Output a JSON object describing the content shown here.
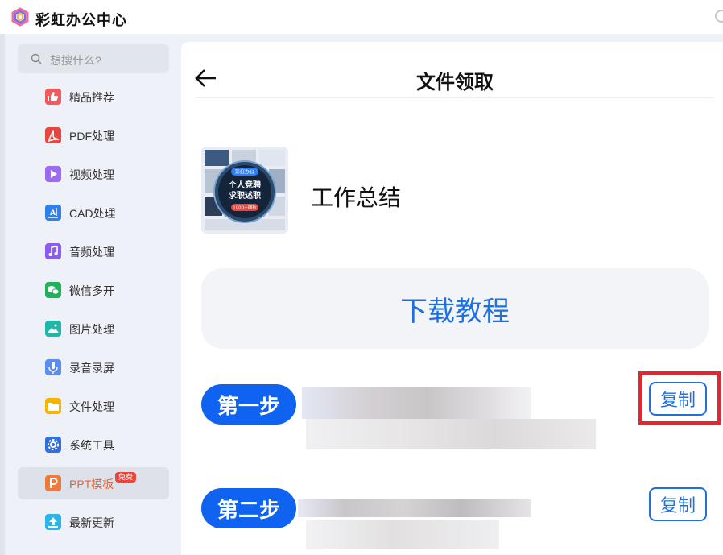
{
  "app": {
    "title": "彩虹办公中心"
  },
  "search": {
    "placeholder": "想搜什么?"
  },
  "sidebar": {
    "items": [
      {
        "label": "精品推荐",
        "icon": "thumbs-up-icon",
        "color": "#f05a5a"
      },
      {
        "label": "PDF处理",
        "icon": "pdf-icon",
        "color": "#e8453c"
      },
      {
        "label": "视频处理",
        "icon": "play-icon",
        "color": "#9b6cf0"
      },
      {
        "label": "CAD处理",
        "icon": "cad-icon",
        "color": "#2f80ed"
      },
      {
        "label": "音频处理",
        "icon": "music-icon",
        "color": "#8a5cf0"
      },
      {
        "label": "微信多开",
        "icon": "wechat-icon",
        "color": "#20b15a"
      },
      {
        "label": "图片处理",
        "icon": "image-icon",
        "color": "#1fb7a8"
      },
      {
        "label": "录音录屏",
        "icon": "mic-icon",
        "color": "#5b8def"
      },
      {
        "label": "文件处理",
        "icon": "folder-icon",
        "color": "#f5b400"
      },
      {
        "label": "系统工具",
        "icon": "gear-icon",
        "color": "#2f6fe0"
      },
      {
        "label": "PPT模板",
        "icon": "ppt-icon",
        "color": "#f07a3a",
        "badge": "免费",
        "active": true
      },
      {
        "label": "最新更新",
        "icon": "upload-icon",
        "color": "#2fb2e8"
      }
    ]
  },
  "main": {
    "title": "文件领取",
    "file": {
      "name": "工作总结",
      "thumb_badge": "彩虹办公",
      "thumb_line1": "个人竞聘",
      "thumb_line2": "求职述职",
      "thumb_count": "1000+模板"
    },
    "tutorial_label": "下载教程",
    "steps": [
      {
        "label": "第一步",
        "copy_label": "复制"
      },
      {
        "label": "第二步",
        "copy_label": "复制"
      }
    ]
  },
  "colors": {
    "accent": "#1063f1",
    "highlight": "#e5262c",
    "active_text": "#e0633a"
  }
}
